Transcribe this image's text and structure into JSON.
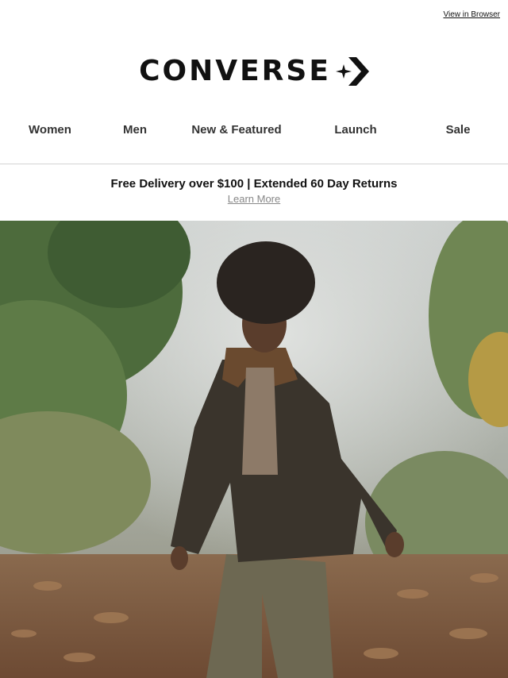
{
  "header": {
    "view_in_browser": "View in Browser",
    "logo_text": "CONVERSE",
    "logo_icon": "converse-star-chevron-icon"
  },
  "nav": {
    "items": [
      {
        "label": "Women"
      },
      {
        "label": "Men"
      },
      {
        "label": "New & Featured"
      },
      {
        "label": "Launch"
      },
      {
        "label": "Sale"
      }
    ]
  },
  "promo": {
    "text": "Free Delivery over $100 | Extended 60 Day Returns",
    "link": "Learn More"
  },
  "hero": {
    "image": "hero-photo-man-walking-in-autumn-forest"
  },
  "colors": {
    "text": "#111111",
    "nav_text": "#333333",
    "link_grey": "#888888",
    "divider": "#d3d3d3"
  }
}
